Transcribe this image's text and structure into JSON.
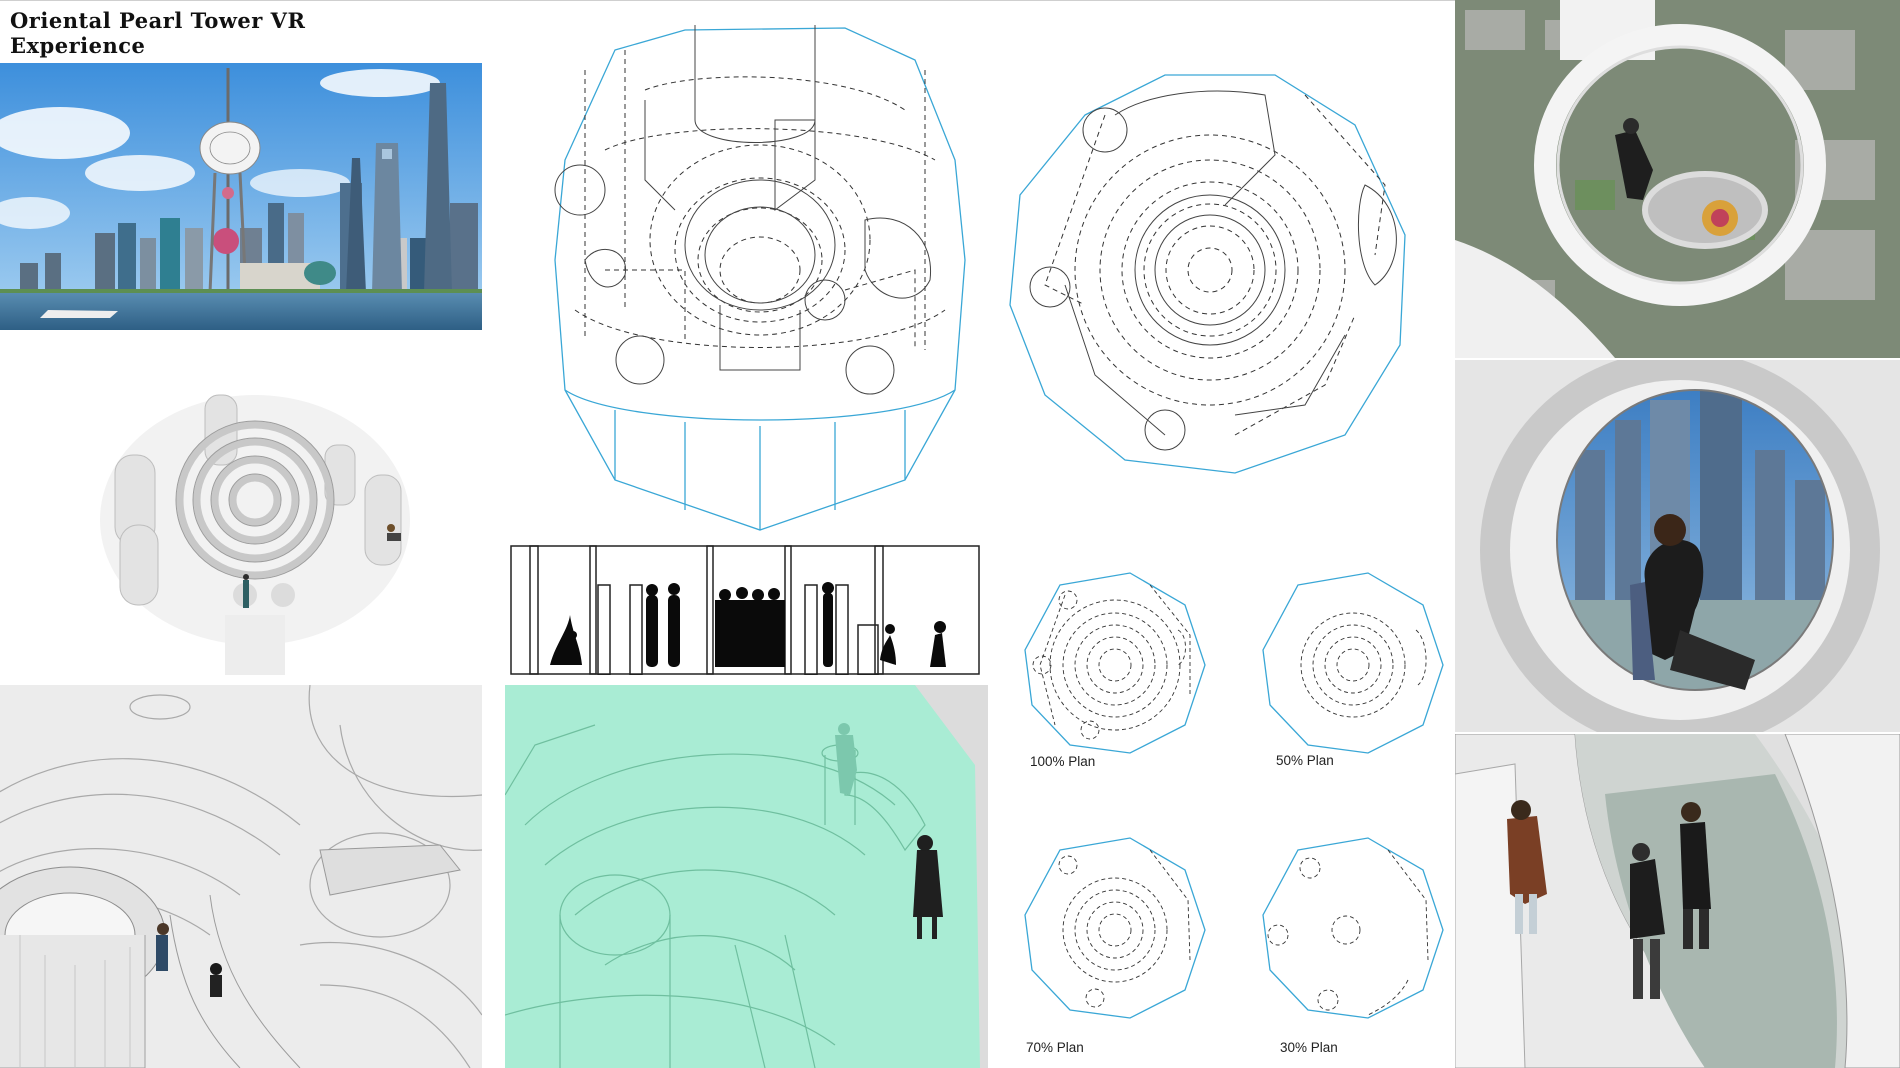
{
  "title_line1": "Oriental Pearl Tower VR",
  "title_line2": "Experience",
  "plans": {
    "p100": "100% Plan",
    "p50": "50% Plan",
    "p70": "70% Plan",
    "p30": "30% Plan"
  },
  "colors": {
    "outline_blue": "#3aa7d6",
    "mint": "#8fe3c6",
    "sky": "#5aa9e6",
    "river": "#4b86b8",
    "render_grey": "#e6e6e6"
  }
}
